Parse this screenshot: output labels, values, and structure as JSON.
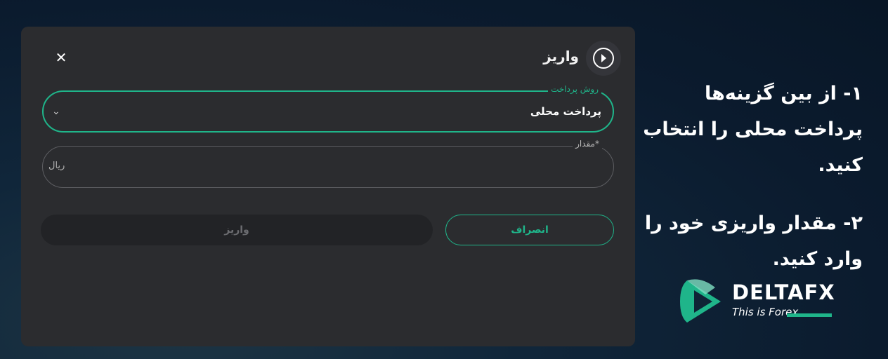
{
  "modal": {
    "title": "واریز",
    "close_symbol": "✕",
    "header_icon": "play-circle-icon",
    "method_field": {
      "label": "روش پرداخت",
      "value": "پرداخت محلی",
      "chevron": "⌄"
    },
    "amount_field": {
      "label": "*مقدار",
      "value": "",
      "currency": "ریال"
    },
    "submit_label": "واریز",
    "cancel_label": "انصراف"
  },
  "instructions": {
    "step1": "۱- از بین گزینه‌ها پرداخت محلی را انتخاب کنید.",
    "step2": "۲- مقدار واریزی خود را وارد کنید."
  },
  "brand": {
    "name": "DELTAFX",
    "tagline": "This is Forex"
  },
  "colors": {
    "accent": "#1fb58a",
    "modal_bg": "#2b2c2f",
    "page_bg": "#0b1b2e"
  }
}
